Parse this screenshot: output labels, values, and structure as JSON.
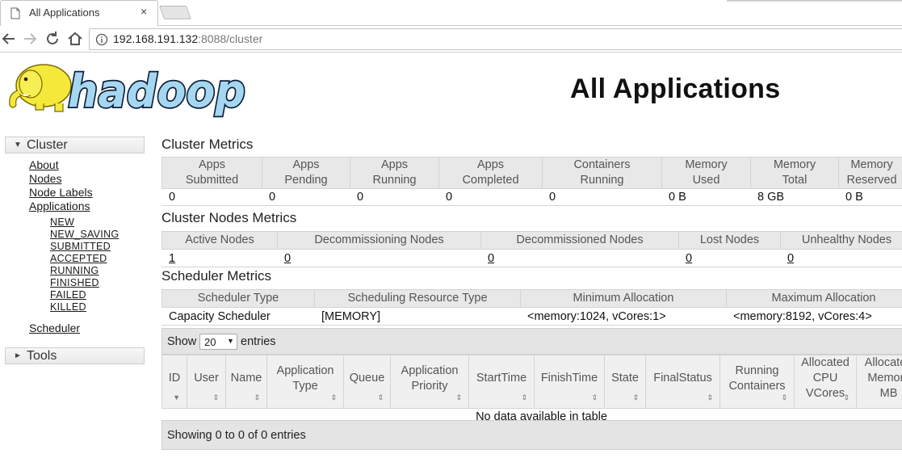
{
  "browser": {
    "tab_title": "All Applications",
    "tab_close": "×",
    "url_host": "192.168.191.132",
    "url_rest": ":8088/cluster"
  },
  "page": {
    "logo_text": "hadoop",
    "title": "All Applications"
  },
  "nav": {
    "cluster_label": "Cluster",
    "cluster_caret": "▼",
    "cluster_links": [
      "About",
      "Nodes",
      "Node Labels",
      "Applications"
    ],
    "app_states": [
      "NEW",
      "NEW_SAVING",
      "SUBMITTED",
      "ACCEPTED",
      "RUNNING",
      "FINISHED",
      "FAILED",
      "KILLED"
    ],
    "scheduler_link": "Scheduler",
    "tools_label": "Tools",
    "tools_caret": "►"
  },
  "cluster_metrics": {
    "title": "Cluster Metrics",
    "headers": [
      [
        "Apps",
        "Submitted"
      ],
      [
        "Apps",
        "Pending"
      ],
      [
        "Apps",
        "Running"
      ],
      [
        "Apps",
        "Completed"
      ],
      [
        "Containers",
        "Running"
      ],
      [
        "Memory",
        "Used"
      ],
      [
        "Memory",
        "Total"
      ],
      [
        "Memory",
        "Reserved"
      ]
    ],
    "values": [
      "0",
      "0",
      "0",
      "0",
      "0",
      "0 B",
      "8 GB",
      "0 B"
    ]
  },
  "node_metrics": {
    "title": "Cluster Nodes Metrics",
    "headers": [
      "Active Nodes",
      "Decommissioning Nodes",
      "Decommissioned Nodes",
      "Lost Nodes",
      "Unhealthy Nodes"
    ],
    "values": [
      "1",
      "0",
      "0",
      "0",
      "0"
    ]
  },
  "scheduler_metrics": {
    "title": "Scheduler Metrics",
    "headers": [
      "Scheduler Type",
      "Scheduling Resource Type",
      "Minimum Allocation",
      "Maximum Allocation"
    ],
    "values": [
      "Capacity Scheduler",
      "[MEMORY]",
      "<memory:1024, vCores:1>",
      "<memory:8192, vCores:4>"
    ]
  },
  "apps_table": {
    "show_label": "Show",
    "page_size": "20",
    "select_arrow": "▼",
    "entries_label": "entries",
    "columns": [
      [
        "ID"
      ],
      [
        "User"
      ],
      [
        "Name"
      ],
      [
        "Application",
        "Type"
      ],
      [
        "Queue"
      ],
      [
        "Application",
        "Priority"
      ],
      [
        "StartTime"
      ],
      [
        "FinishTime"
      ],
      [
        "State"
      ],
      [
        "FinalStatus"
      ],
      [
        "Running",
        "Containers"
      ],
      [
        "Allocated",
        "CPU",
        "VCores"
      ],
      [
        "Allocated",
        "Memory",
        "MB"
      ]
    ],
    "sort_icons": [
      "▲▼",
      "⇕"
    ],
    "empty_message": "No data available in table",
    "footer_text": "Showing 0 to 0 of 0 entries"
  }
}
